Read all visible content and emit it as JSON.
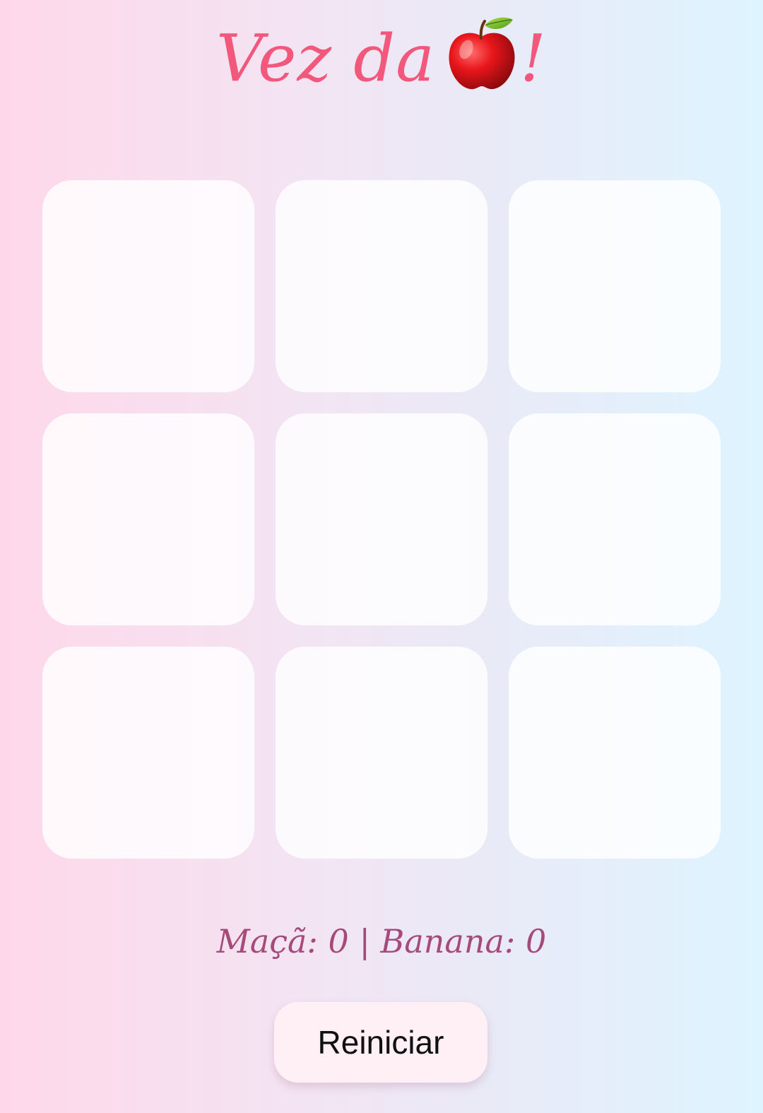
{
  "header": {
    "turn_prefix": "Vez da",
    "turn_player_icon": "red-apple-icon",
    "turn_suffix": "!"
  },
  "board": {
    "cells": [
      "",
      "",
      "",
      "",
      "",
      "",
      "",
      "",
      ""
    ]
  },
  "scoreboard": {
    "text": "Maçã: 0 | Banana: 0"
  },
  "reset_button": {
    "label": "Reiniciar"
  },
  "colors": {
    "title": "#f2587c",
    "score": "#a64a7b",
    "background_left": "#fed8ea",
    "background_right": "#def4ff",
    "cell": "#ffffff",
    "button": "#fff0f5"
  }
}
